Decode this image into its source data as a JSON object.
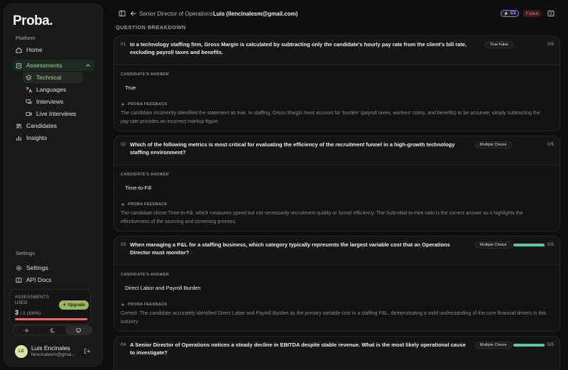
{
  "app": {
    "logo": "Proba."
  },
  "sidebar": {
    "platform_label": "Platform",
    "settings_label": "Settings",
    "items": {
      "home": "Home",
      "assessments": "Assessments",
      "technical": "Technical",
      "languages": "Languages",
      "interviews": "Interviews",
      "live_interviews": "Live Interviews",
      "candidates": "Candidates",
      "insights": "Insights",
      "settings": "Settings",
      "api_docs": "API Docs"
    },
    "usage": {
      "label": "ASSESSMENTS USED",
      "count": "3",
      "total": "/ 3",
      "percent_text": "(100%)",
      "fill_fraction": 1.0,
      "upgrade_label": "Upgrade"
    },
    "user": {
      "initials": "LE",
      "name": "Luis Encinales",
      "email": "llencinalesm@gmai..."
    }
  },
  "header": {
    "role": "Senior Director of Operations",
    "candidate": "Luis (llencinalesm@gmail.com)",
    "level_badge": "C1",
    "status_badge": "Failed"
  },
  "section_title": "QUESTION BREAKDOWN",
  "answer_label": "CANDIDATE'S ANSWER",
  "feedback_label": "PROBA FEEDBACK",
  "questions": [
    {
      "num": "01",
      "text": "In a technology staffing firm, Gross Margin is calculated by subtracting only the candidate's hourly pay rate from the client's bill rate, excluding payroll taxes and benefits.",
      "type": "True False",
      "score": "0/5",
      "progress": 0,
      "answer": "True",
      "feedback": "The candidate incorrectly identified the statement as true. In staffing, Gross Margin must account for 'burden' (payroll taxes, workers' comp, and benefits) to be accurate; simply subtracting the pay rate provides an incorrect markup figure."
    },
    {
      "num": "02",
      "text": "Which of the following metrics is most critical for evaluating the efficiency of the recruitment funnel in a high-growth technology staffing environment?",
      "type": "Multiple Choice",
      "score": "0/5",
      "progress": 0,
      "answer": "Time-to-Fill",
      "feedback": "The candidate chose Time-to-Fill, which measures speed but not necessarily recruitment quality or funnel efficiency. The Submittal-to-Hire ratio is the correct answer as it highlights the effectiveness of the sourcing and screening process."
    },
    {
      "num": "03",
      "text": "When managing a P&L for a staffing business, which category typically represents the largest variable cost that an Operations Director must monitor?",
      "type": "Multiple Choice",
      "score": "5/5",
      "progress": 1.0,
      "answer": "Direct Labor and Payroll Burden",
      "feedback": "Correct. The candidate accurately identified Direct Labor and Payroll Burden as the primary variable cost in a staffing P&L, demonstrating a solid understanding of the core financial drivers in this industry."
    },
    {
      "num": "04",
      "text": "A Senior Director of Operations notices a steady decline in EBITDA despite stable revenue. What is the most likely operational cause to investigate?",
      "type": "Multiple Choice",
      "score": "5/5",
      "progress": 1.0,
      "answer": "",
      "feedback": ""
    }
  ],
  "colors": {
    "accent_green": "#9fd39f",
    "progress_green": "#5cc89a",
    "failed_red": "#e07070",
    "level_purple": "#7f7fd8"
  }
}
